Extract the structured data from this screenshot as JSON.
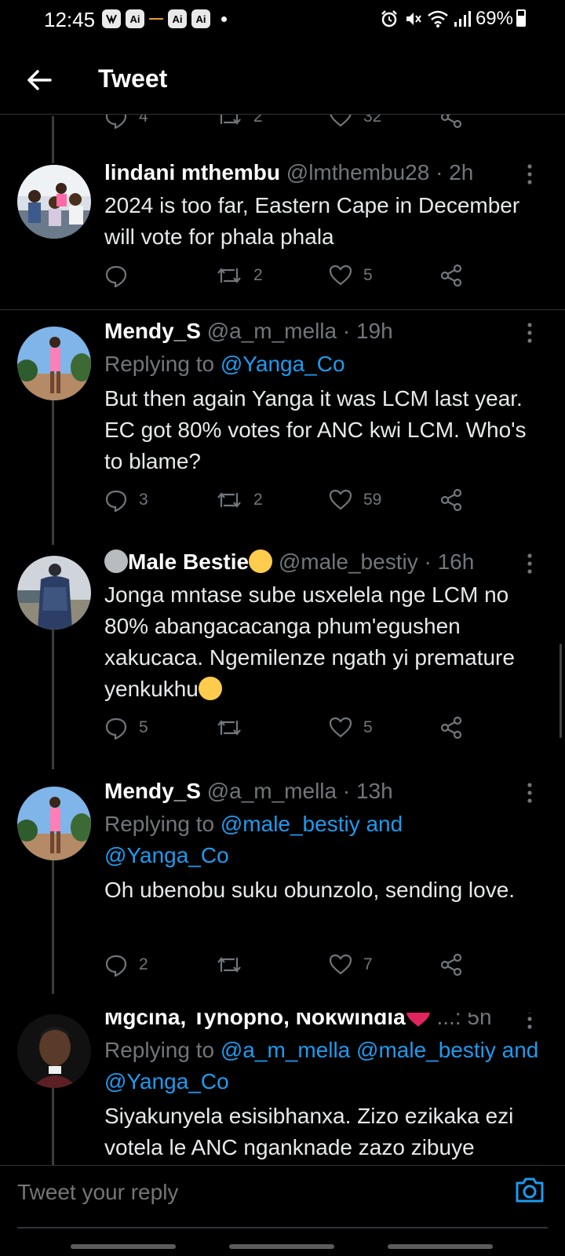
{
  "status_bar": {
    "time": "12:45",
    "app_icons": [
      "messenger-icon",
      "ai-icon",
      "ai-icon",
      "ai-icon"
    ],
    "battery": "69%"
  },
  "header": {
    "title": "Tweet"
  },
  "partial_tweet": {
    "replies": "4",
    "retweets": "2",
    "likes": "32"
  },
  "tweets": [
    {
      "name": "lindani mthembu",
      "handle": "@lmthembu28 · 2h",
      "body": "2024 is too far, Eastern Cape in December will vote for phala phala",
      "replies": "",
      "retweets": "2",
      "likes": "5"
    },
    {
      "name": "Mendy_S",
      "handle": "@a_m_mella · 19h",
      "replying_prefix": "Replying to ",
      "replying_links": "@Yanga_Co",
      "body": "But then again Yanga it was LCM last year. EC got 80% votes for ANC kwi LCM. Who's to blame?",
      "replies": "3",
      "retweets": "2",
      "likes": "59"
    },
    {
      "name": "Male Bestie",
      "handle": "@male_bestiy · 16h",
      "body": "Jonga mntase sube usxelela nge LCM no 80% abangacacanga phum'egushen xakucaca. Ngemilenze ngath yi premature yenkukhu",
      "replies": "5",
      "retweets": "",
      "likes": "5"
    },
    {
      "name": "Mendy_S",
      "handle": "@a_m_mella · 13h",
      "replying_prefix": "Replying to ",
      "replying_links": "@male_bestiy and @Yanga_Co",
      "body": "Oh ubenobu suku obunzolo, sending love.",
      "replies": "2",
      "retweets": "",
      "likes": "7"
    },
    {
      "name": "Mgcina, Tyhopho, Nokwindla",
      "handle": "...: 5h",
      "replying_prefix": "Replying to ",
      "replying_links": "@a_m_mella @male_bestiy and @Yanga_Co",
      "body": "Siyakunyela esisibhanxa. Zizo ezikaka ezi votela le ANC nganknade zazo zibuye"
    }
  ],
  "reply_bar": {
    "placeholder": "Tweet your reply"
  },
  "colors": {
    "background": "#000000",
    "link": "#1d9bf0",
    "muted": "#71767b",
    "heart": "#e0245e"
  }
}
